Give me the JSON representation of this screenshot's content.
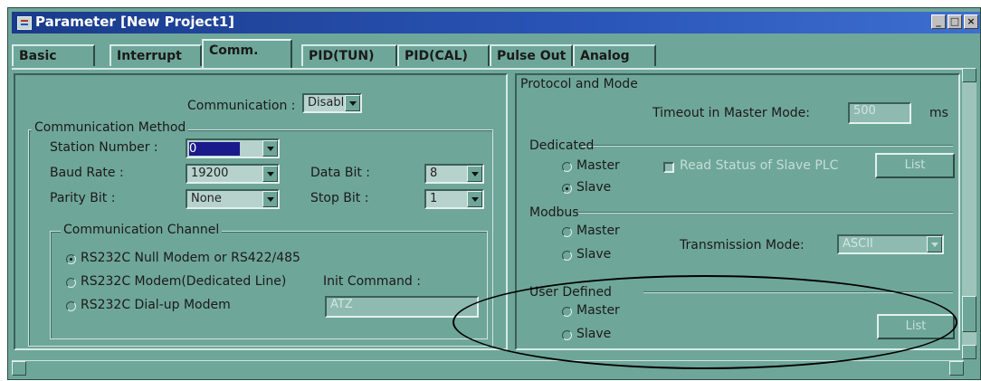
{
  "window": {
    "title": "Parameter [New Project1]"
  },
  "tabs": [
    {
      "label": "Basic"
    },
    {
      "label": "Interrupt"
    },
    {
      "label": "Comm."
    },
    {
      "label": "PID(TUN)"
    },
    {
      "label": "PID(CAL)"
    },
    {
      "label": "Pulse Out"
    },
    {
      "label": "Analog"
    }
  ],
  "active_tab": "Comm.",
  "communication": {
    "label": "Communication :",
    "value": "Disable"
  },
  "method": {
    "title": "Communication Method",
    "station_label": "Station Number :",
    "station_value": "0",
    "baud_label": "Baud Rate :",
    "baud_value": "19200",
    "databit_label": "Data Bit :",
    "databit_value": "8",
    "parity_label": "Parity Bit :",
    "parity_value": "None",
    "stopbit_label": "Stop Bit :",
    "stopbit_value": "1"
  },
  "channel": {
    "title": "Communication Channel",
    "options": [
      {
        "label": "RS232C Null Modem or RS422/485",
        "selected": true
      },
      {
        "label": "RS232C Modem(Dedicated Line)",
        "selected": false
      },
      {
        "label": "RS232C Dial-up Modem",
        "selected": false
      }
    ],
    "init_label": "Init Command :",
    "init_value": "ATZ"
  },
  "protocol": {
    "title": "Protocol and Mode",
    "timeout_label": "Timeout in Master Mode:",
    "timeout_value": "500",
    "timeout_unit": "ms",
    "dedicated": {
      "title": "Dedicated",
      "master": "Master",
      "slave": "Slave",
      "selected": "Slave",
      "read_status": "Read Status of Slave PLC",
      "list": "List"
    },
    "modbus": {
      "title": "Modbus",
      "master": "Master",
      "slave": "Slave",
      "tx_label": "Transmission Mode:",
      "tx_value": "ASCII"
    },
    "user": {
      "title": "User Defined",
      "master": "Master",
      "slave": "Slave",
      "list": "List"
    }
  },
  "colors": {
    "window_bg": "#6fa69a",
    "title_bar": "#1a3b8a",
    "annotation": "#000000"
  }
}
